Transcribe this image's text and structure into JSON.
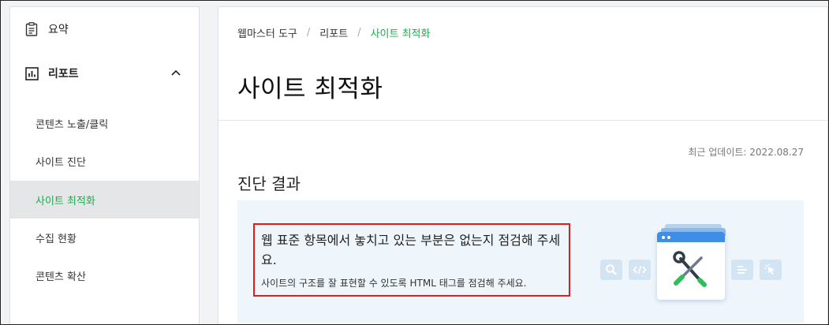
{
  "sidebar": {
    "summary": {
      "label": "요약",
      "icon": "clipboard-icon"
    },
    "report": {
      "label": "리포트",
      "icon": "bar-chart-icon",
      "expanded": true
    },
    "items": [
      {
        "label": "콘텐츠 노출/클릭",
        "active": false
      },
      {
        "label": "사이트 진단",
        "active": false
      },
      {
        "label": "사이트 최적화",
        "active": true
      },
      {
        "label": "수집 현황",
        "active": false
      },
      {
        "label": "콘텐츠 확산",
        "active": false
      }
    ]
  },
  "breadcrumb": [
    "웹마스터 도구",
    "리포트",
    "사이트 최적화"
  ],
  "page_title": "사이트 최적화",
  "last_updated": "최근 업데이트: 2022.08.27",
  "section_title": "진단 결과",
  "banner": {
    "headline": "웹 표준 항목에서 놓치고 있는 부분은 없는지 점검해 주세요.",
    "description": "사이트의 구조를 잘 표현할 수 있도록 HTML 태그를 점검해 주세요.",
    "icons": [
      "search-icon",
      "code-icon",
      "tools-icon",
      "text-align-icon",
      "cursor-icon"
    ]
  },
  "colors": {
    "accent": "#19ad4b",
    "highlight_border": "#e21b1b",
    "banner_bg": "#eef5fb",
    "active_bg": "#e5e6e8"
  }
}
